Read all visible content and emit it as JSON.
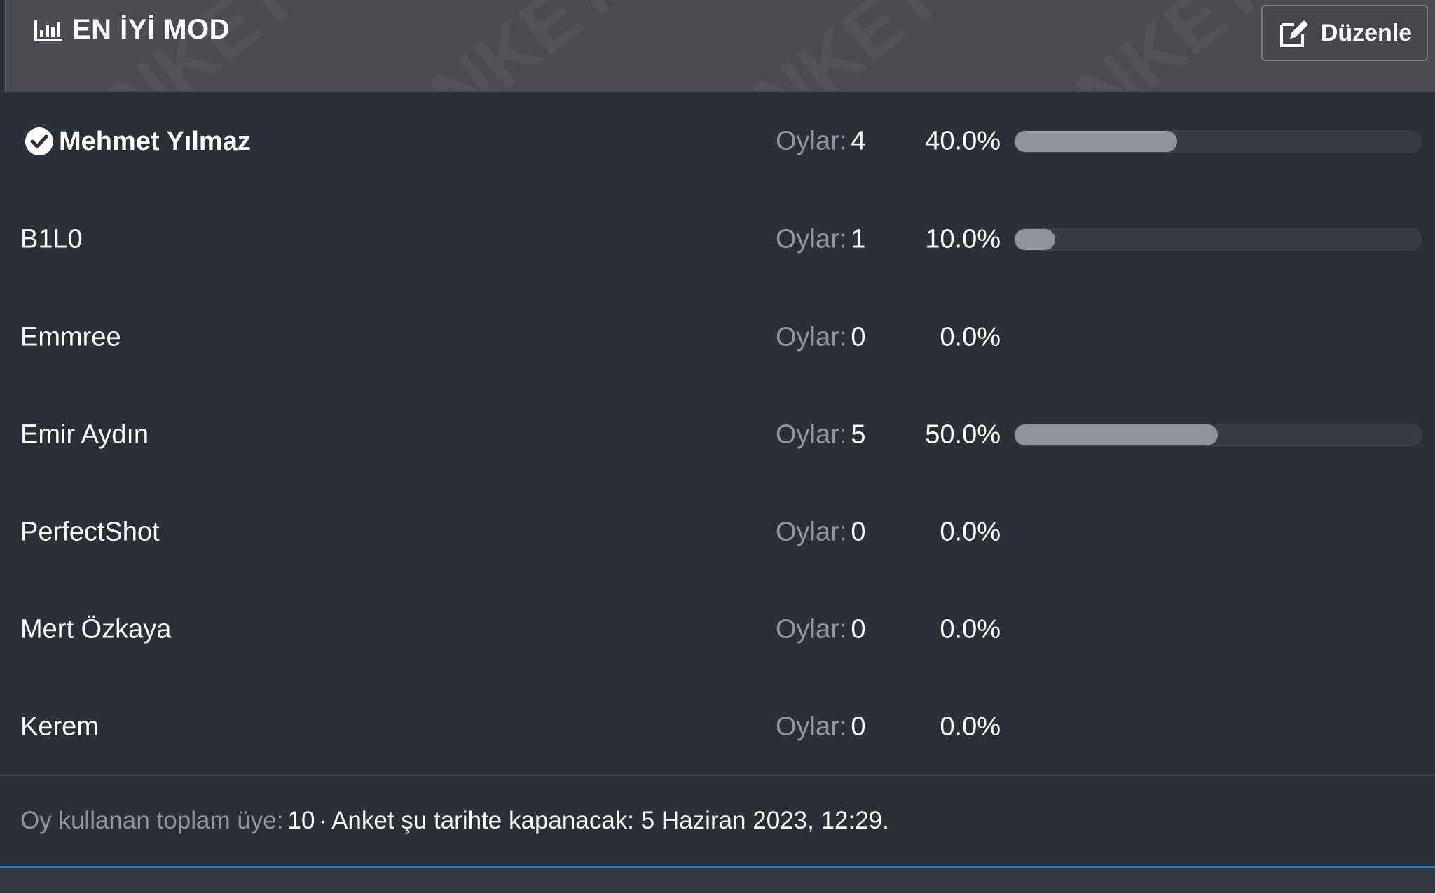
{
  "header": {
    "title": "EN İYİ MOD",
    "edit_label": "Düzenle",
    "title_icon": "bar-chart-icon",
    "edit_icon": "edit-icon"
  },
  "votes_label": "Oylar:",
  "options": [
    {
      "label": "Mehmet Yılmaz",
      "votes": "4",
      "percent": "40.0%",
      "fraction": 0.4,
      "voted": true
    },
    {
      "label": "B1L0",
      "votes": "1",
      "percent": "10.0%",
      "fraction": 0.1,
      "voted": false
    },
    {
      "label": "Emmree",
      "votes": "0",
      "percent": "0.0%",
      "fraction": 0,
      "voted": false
    },
    {
      "label": "Emir Aydın",
      "votes": "5",
      "percent": "50.0%",
      "fraction": 0.5,
      "voted": false
    },
    {
      "label": "PerfectShot",
      "votes": "0",
      "percent": "0.0%",
      "fraction": 0,
      "voted": false
    },
    {
      "label": "Mert Özkaya",
      "votes": "0",
      "percent": "0.0%",
      "fraction": 0,
      "voted": false
    },
    {
      "label": "Kerem",
      "votes": "0",
      "percent": "0.0%",
      "fraction": 0,
      "voted": false
    }
  ],
  "footer": {
    "total_label": "Oy kullanan toplam üye:",
    "total_value": "10",
    "separator": "·",
    "close_text": "Anket şu tarihte kapanacak: 5 Haziran 2023, 12:29."
  },
  "colors": {
    "background": "#2c2f37",
    "header_bg": "#4a4c52",
    "bar_fill": "#8f939a",
    "bar_track": "#383b43",
    "muted_text": "#8f96a3",
    "accent_line": "#2f7bbd"
  }
}
